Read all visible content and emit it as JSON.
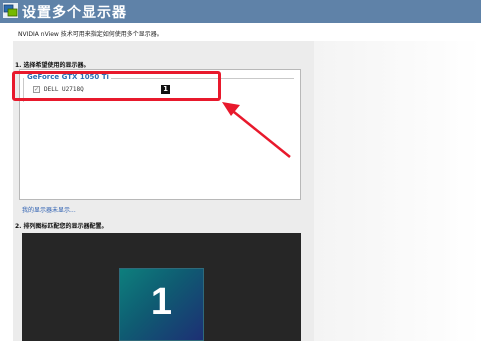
{
  "header": {
    "icon": "nvidia-display-icon",
    "title": "设置多个显示器"
  },
  "subtitle": "NVIDIA nView 技术可用来指定如何使用多个显示器。",
  "step1": {
    "label": "1. 选择希望使用的显示器。"
  },
  "gpu_group": {
    "title": "GeForce GTX 1050 Ti"
  },
  "monitor": {
    "label": "DELL U2718Q",
    "checked": true,
    "number": "1"
  },
  "missing_link": "我的显示器未显示...",
  "step2": {
    "label": "2. 排列图标匹配您的显示器配置。"
  },
  "arrangement": {
    "tile_number": "1"
  },
  "colors": {
    "header": "#5f82a8",
    "highlight": "#e8192c",
    "link": "#2a5db0",
    "tile_gradient": [
      "#0d7f7d",
      "#1d2f74"
    ]
  }
}
